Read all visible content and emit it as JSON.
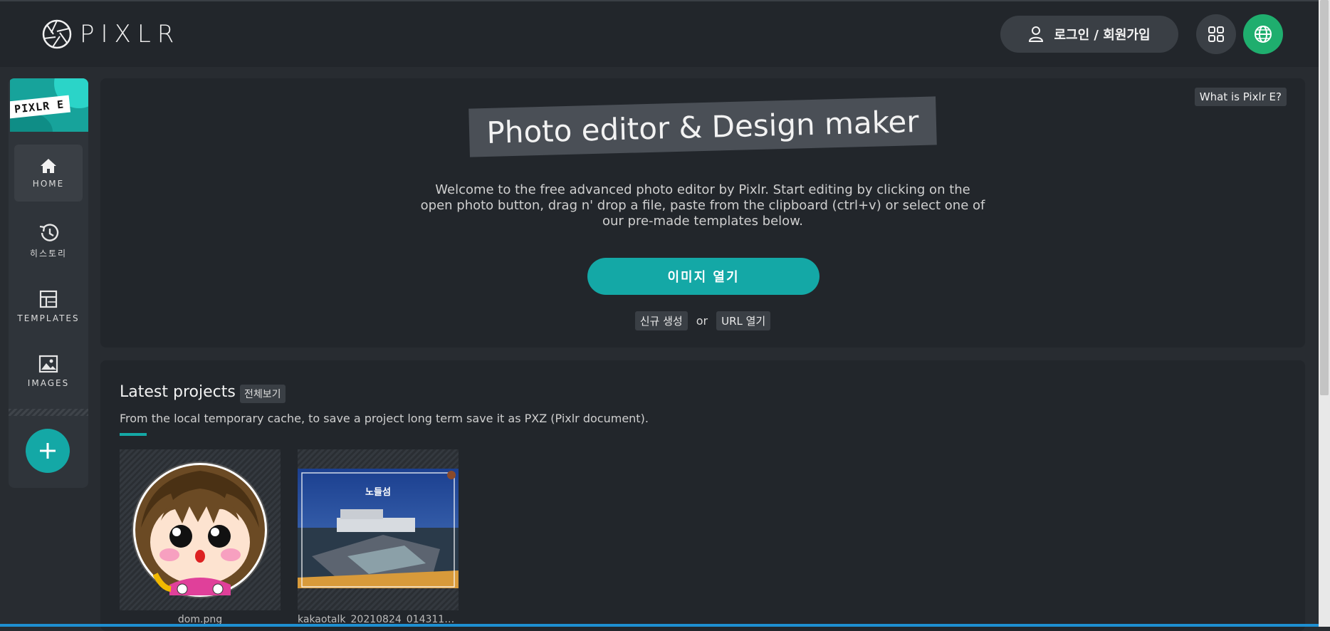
{
  "header": {
    "logo_text": "PIXLR",
    "login_label": "로그인 / 회원가입",
    "icons": [
      "pixlr-logo-icon",
      "user-icon",
      "apps-grid-icon",
      "globe-icon"
    ],
    "colors": {
      "bar": "#22262b",
      "globe_button": "#1fae6e"
    }
  },
  "sidebar": {
    "brand_label": "PIXLR E",
    "items": [
      {
        "label": "HOME",
        "icon": "home-icon",
        "active": true
      },
      {
        "label": "히스토리",
        "icon": "history-icon",
        "active": false
      },
      {
        "label": "TEMPLATES",
        "icon": "templates-icon",
        "active": false
      },
      {
        "label": "IMAGES",
        "icon": "image-icon",
        "active": false
      }
    ],
    "add_icon": "plus-icon",
    "accent": "#14a8a6"
  },
  "hero": {
    "what_is": "What is Pixlr E?",
    "title": "Photo editor & Design maker",
    "description": "Welcome to the free advanced photo editor by Pixlr. Start editing by clicking on the open photo button, drag n' drop a file, paste from the clipboard (ctrl+v) or select one of our pre-made templates below.",
    "open_button": "이미지 열기",
    "new_label": "신규 생성",
    "or_text": "or",
    "url_label": "URL 열기"
  },
  "projects": {
    "title": "Latest projects",
    "see_all": "전체보기",
    "description": "From the local temporary cache, to save a project long term save it as PXZ (Pixlr document).",
    "items": [
      {
        "name": "dom.png"
      },
      {
        "name": "kakaotalk_20210824_01431106...",
        "overlay_text": "노들섬"
      }
    ]
  }
}
